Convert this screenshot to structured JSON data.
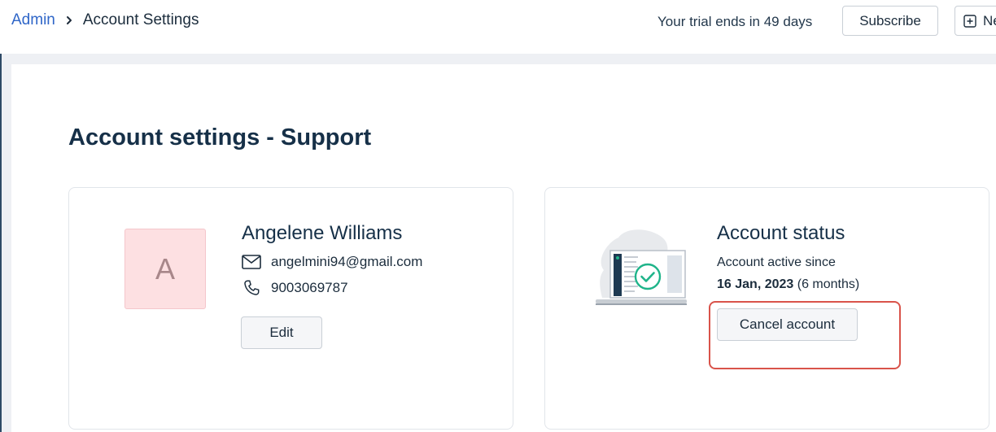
{
  "breadcrumb": {
    "root": "Admin",
    "current": "Account Settings"
  },
  "header": {
    "trial_text": "Your trial ends in 49 days",
    "subscribe_label": "Subscribe",
    "new_label": "Ne"
  },
  "page": {
    "title": "Account settings - Support"
  },
  "profile": {
    "avatar_initial": "A",
    "name": "Angelene Williams",
    "email": "angelmini94@gmail.com",
    "phone": "9003069787",
    "edit_label": "Edit"
  },
  "account_status": {
    "title": "Account status",
    "active_since_label": "Account active since",
    "since_date": "16 Jan, 2023",
    "duration": "(6 months)",
    "cancel_label": "Cancel account"
  },
  "colors": {
    "link": "#2f66c8",
    "highlight": "#d9534a",
    "avatar_bg": "#fde0e2",
    "accent_check": "#1fb48a"
  },
  "icons": [
    "chevron-right-icon",
    "plus-square-icon",
    "mail-icon",
    "phone-icon",
    "laptop-check-illustration"
  ]
}
